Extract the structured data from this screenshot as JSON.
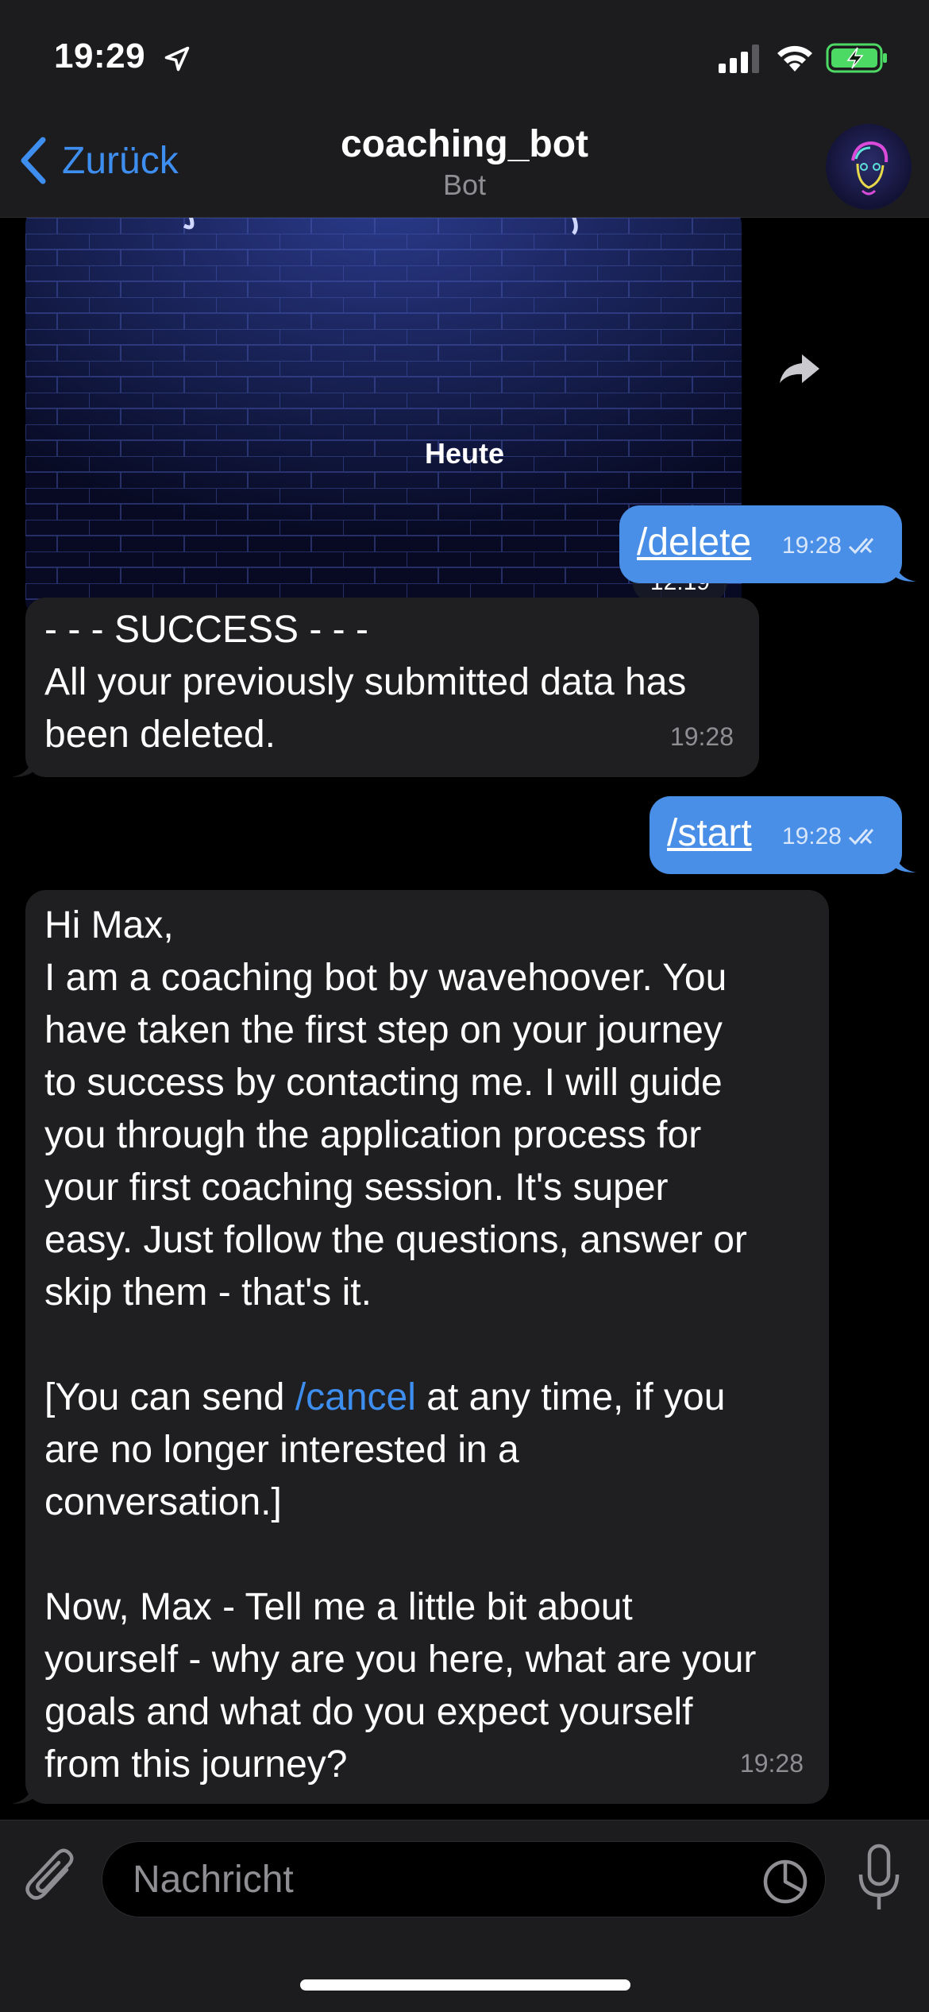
{
  "status": {
    "time": "19:29"
  },
  "header": {
    "back_label": "Zurück",
    "title": "coaching_bot",
    "subtitle": "Bot"
  },
  "chat": {
    "image_time": "12:19",
    "date_separator": "Heute",
    "messages": [
      {
        "dir": "out",
        "text": "/delete",
        "time": "19:28"
      },
      {
        "dir": "in",
        "lines": [
          "- - - SUCCESS - - -",
          "All your previously submitted data has",
          "been deleted."
        ],
        "time": "19:28"
      },
      {
        "dir": "out",
        "text": "/start",
        "time": "19:28"
      },
      {
        "dir": "in",
        "para1": [
          "Hi Max,",
          "I am a coaching bot by wavehoover. You",
          "have taken the first step on your journey",
          "to success by contacting me. I will guide",
          "you through the application process for",
          "your first coaching session. It's super",
          "easy. Just follow the questions, answer or",
          "skip them - that's it."
        ],
        "para2_prefix": "[You can send ",
        "para2_link": "/cancel",
        "para2_suffix": " at any time, if you",
        "para2_rest": [
          "are no longer interested in a",
          "conversation.]"
        ],
        "para3": [
          "Now, Max - Tell me a little bit about",
          "yourself - why are you here, what are your",
          "goals and what do you expect yourself",
          "from this journey?"
        ],
        "time": "19:28"
      }
    ]
  },
  "composer": {
    "placeholder": "Nachricht"
  },
  "colors": {
    "accent": "#3e8ef0",
    "outgoing_bubble": "#4a8fe7",
    "incoming_bubble": "#1f1f21",
    "battery_green": "#4cd964"
  }
}
